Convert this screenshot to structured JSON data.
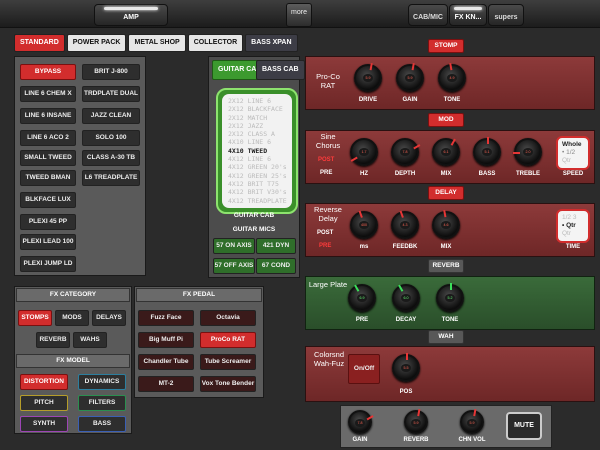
{
  "topbar": {
    "amp_tab": "AMP",
    "more": "more",
    "cabmic_tab": "CAB/MIC",
    "fxkn_tab": "FX KN...",
    "supers_tab": "supers"
  },
  "amp_categories": [
    "STANDARD",
    "POWER PACK",
    "METAL SHOP",
    "COLLECTOR",
    "BASS XPAN"
  ],
  "amp_models_left": [
    "BYPASS",
    "LINE 6 CHEM X",
    "LINE 6 INSANE",
    "LINE 6 ACO 2",
    "SMALL TWEED",
    "TWEED BMAN",
    "BLKFACE LUX",
    "PLEXI 45 PP",
    "PLEXI LEAD 100",
    "PLEXI JUMP LD"
  ],
  "amp_models_right": [
    "BRIT J-800",
    "TRDPLATE DUAL",
    "JAZZ CLEAN",
    "SOLO 100",
    "CLASS A-30 TB",
    "L6 TREADPLATE"
  ],
  "cab_tabs": [
    "GUITAR CAB",
    "BASS CAB"
  ],
  "cab_list": [
    "2X12 LINE 6",
    "2X12 BLACKFACE",
    "2X12 MATCH",
    "2X12 JAZZ",
    "2X12 CLASS A",
    "4X10 LINE 6",
    "4X10 TWEED",
    "4X12 LINE 6",
    "4X12 GREEN 20's",
    "4X12 GREEN 25's",
    "4X12 BRIT T75",
    "4X12 BRIT V30's",
    "4X12 TREADPLATE"
  ],
  "cab_selected": "4X10 TWEED",
  "cab_caption": "GUITAR CAB",
  "mics": {
    "title": "GUITAR MICS",
    "items": [
      "57 ON AXIS",
      "421 DYN",
      "57 OFF AXIS",
      "67 COND"
    ]
  },
  "fx_category": {
    "title": "FX CATEGORY",
    "items": [
      "STOMPS",
      "MODS",
      "DELAYS",
      "REVERB",
      "WAHS"
    ]
  },
  "fx_model": {
    "title": "FX MODEL",
    "items": [
      "DISTORTION",
      "DYNAMICS",
      "PITCH",
      "FILTERS",
      "SYNTH",
      "BASS"
    ]
  },
  "fx_pedal": {
    "title": "FX PEDAL",
    "items": [
      "Fuzz Face",
      "Octavia",
      "Big Muff Pi",
      "ProCo RAT",
      "Chandler Tube",
      "Tube Screamer",
      "MT-2",
      "Vox Tone Bender"
    ]
  },
  "stomp": {
    "header": "STOMP",
    "name": "Pro-Co RAT",
    "knobs": [
      "DRIVE",
      "GAIN",
      "TONE"
    ],
    "values": [
      "5.9",
      "5.9",
      "4.9"
    ]
  },
  "mod": {
    "header": "MOD",
    "name": "Sine Chorus",
    "post": "POST",
    "pre": "PRE",
    "knobs": [
      "HZ",
      "DEPTH",
      "MIX",
      "BASS",
      "TREBLE"
    ],
    "values": [
      "1.7",
      "7.8",
      "6.1",
      "5.1",
      "2.0"
    ],
    "speed_label": "SPEED",
    "speed_options": [
      "Whole",
      "• 1/2",
      "Qtr"
    ]
  },
  "delay": {
    "header": "DELAY",
    "name": "Reverse Delay",
    "post": "POST",
    "pre": "PRE",
    "knobs": [
      "ms",
      "FEEDBK",
      "MIX"
    ],
    "values": [
      "400",
      "4.3",
      "4.6"
    ],
    "time_label": "TIME",
    "time_options": [
      "1/2 3",
      "• Qtr",
      "Qtr"
    ]
  },
  "reverb": {
    "header": "REVERB",
    "name": "Large Plate",
    "knobs": [
      "PRE",
      "DECAY",
      "TONE"
    ],
    "values": [
      "6.9",
      "6.0",
      "5.2"
    ]
  },
  "wah": {
    "header": "WAH",
    "name": "Colorsnd Wah-Fuz",
    "onoff": "On/Off",
    "knob": "POS",
    "value": "5.5"
  },
  "bottom": {
    "knobs": [
      "GAIN",
      "REVERB",
      "CHN VOL"
    ],
    "values": [
      "7.8",
      "5.9",
      "5.9"
    ],
    "mute": "MUTE"
  },
  "colors": {
    "accent_red": "#d22d2d",
    "green": "#3a8f2a"
  }
}
